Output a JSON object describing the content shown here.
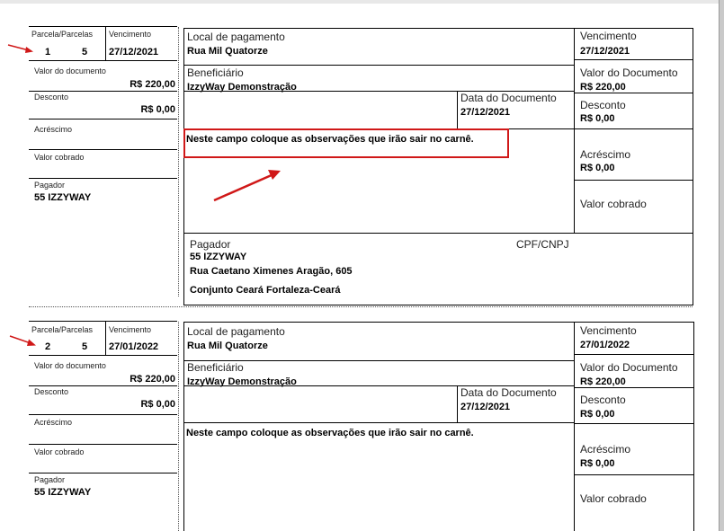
{
  "labels": {
    "parcela": "Parcela/Parcelas",
    "vencimento": "Vencimento",
    "valor_documento_small": "Valor do documento",
    "valor_documento": "Valor do Documento",
    "desconto": "Desconto",
    "acrescimo": "Acréscimo",
    "valor_cobrado": "Valor cobrado",
    "pagador": "Pagador",
    "local_pagamento": "Local de pagamento",
    "beneficiario": "Beneficiário",
    "data_documento": "Data do Documento",
    "cpf_cnpj": "CPF/CNPJ"
  },
  "slips": [
    {
      "parcela": "1",
      "parcelas": "5",
      "vencimento": "27/12/2021",
      "valor_documento": "R$ 220,00",
      "desconto": "R$ 0,00",
      "acrescimo": "R$ 0,00",
      "pagador_nome": "55 IZZYWAY",
      "local_pagamento": "Rua Mil Quatorze",
      "beneficiario": "IzzyWay Demonstração",
      "data_documento": "27/12/2021",
      "observacoes": "Neste campo coloque as observações que irão sair no carnê.",
      "pagador_endereco": "Rua Caetano Ximenes Aragão, 605",
      "pagador_cidade": "Conjunto Ceará Fortaleza-Ceará"
    },
    {
      "parcela": "2",
      "parcelas": "5",
      "vencimento": "27/01/2022",
      "valor_documento": "R$ 220,00",
      "desconto": "R$ 0,00",
      "acrescimo": "R$ 0,00",
      "pagador_nome": "55 IZZYWAY",
      "local_pagamento": "Rua Mil Quatorze",
      "beneficiario": "IzzyWay Demonstração",
      "data_documento": "27/12/2021",
      "observacoes": "Neste campo coloque as observações que irão sair no carnê."
    }
  ],
  "annotation_color": "#d01818",
  "icons": [
    "red-arrow-icon"
  ]
}
